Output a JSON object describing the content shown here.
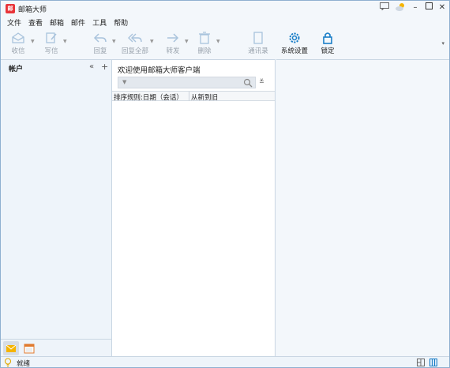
{
  "app": {
    "title": "邮箱大师",
    "logo_text": "邮"
  },
  "menu": [
    "文件",
    "查看",
    "邮箱",
    "邮件",
    "工具",
    "帮助"
  ],
  "toolbar": {
    "receive": "收信",
    "compose": "写信",
    "reply": "回复",
    "reply_all": "回复全部",
    "forward": "转发",
    "delete": "删除",
    "contacts": "通讯录",
    "settings": "系统设置",
    "lock": "锁定"
  },
  "accounts": {
    "title": "帐户"
  },
  "mail_list": {
    "welcome": "欢迎使用邮箱大师客户端",
    "sort_rule": "排序规则:日期（会话）",
    "sort_order": "从新到旧"
  },
  "status": {
    "text": "就绪"
  },
  "colors": {
    "accent": "#1a7ec7",
    "logo": "#e8343a"
  }
}
